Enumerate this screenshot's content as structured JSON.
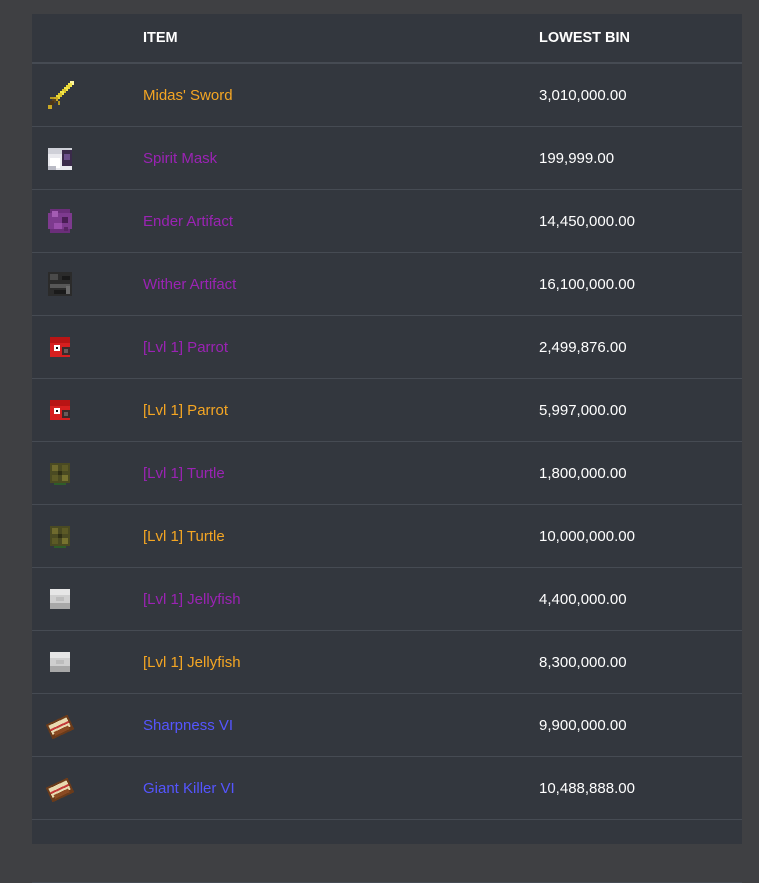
{
  "headers": {
    "icon": "",
    "item": "ITEM",
    "price": "LOWEST BIN"
  },
  "colors": {
    "legendary": "#f5a623",
    "epic": "#9b23b4",
    "rare": "#5555ff"
  },
  "rows": [
    {
      "icon": "golden-sword-icon",
      "name": "Midas' Sword",
      "rarity": "legendary",
      "price": "3,010,000.00"
    },
    {
      "icon": "spirit-mask-icon",
      "name": "Spirit Mask",
      "rarity": "epic",
      "price": "199,999.00"
    },
    {
      "icon": "ender-artifact-icon",
      "name": "Ender Artifact",
      "rarity": "epic",
      "price": "14,450,000.00"
    },
    {
      "icon": "wither-artifact-icon",
      "name": "Wither Artifact",
      "rarity": "epic",
      "price": "16,100,000.00"
    },
    {
      "icon": "parrot-head-icon",
      "name": "[Lvl 1] Parrot",
      "rarity": "epic",
      "price": "2,499,876.00"
    },
    {
      "icon": "parrot-head-icon",
      "name": "[Lvl 1] Parrot",
      "rarity": "legendary",
      "price": "5,997,000.00"
    },
    {
      "icon": "turtle-head-icon",
      "name": "[Lvl 1] Turtle",
      "rarity": "epic",
      "price": "1,800,000.00"
    },
    {
      "icon": "turtle-head-icon",
      "name": "[Lvl 1] Turtle",
      "rarity": "legendary",
      "price": "10,000,000.00"
    },
    {
      "icon": "jellyfish-head-icon",
      "name": "[Lvl 1] Jellyfish",
      "rarity": "epic",
      "price": "4,400,000.00"
    },
    {
      "icon": "jellyfish-head-icon",
      "name": "[Lvl 1] Jellyfish",
      "rarity": "legendary",
      "price": "8,300,000.00"
    },
    {
      "icon": "enchanted-book-icon",
      "name": "Sharpness VI",
      "rarity": "rare",
      "price": "9,900,000.00"
    },
    {
      "icon": "enchanted-book-icon",
      "name": "Giant Killer VI",
      "rarity": "rare",
      "price": "10,488,888.00"
    }
  ]
}
